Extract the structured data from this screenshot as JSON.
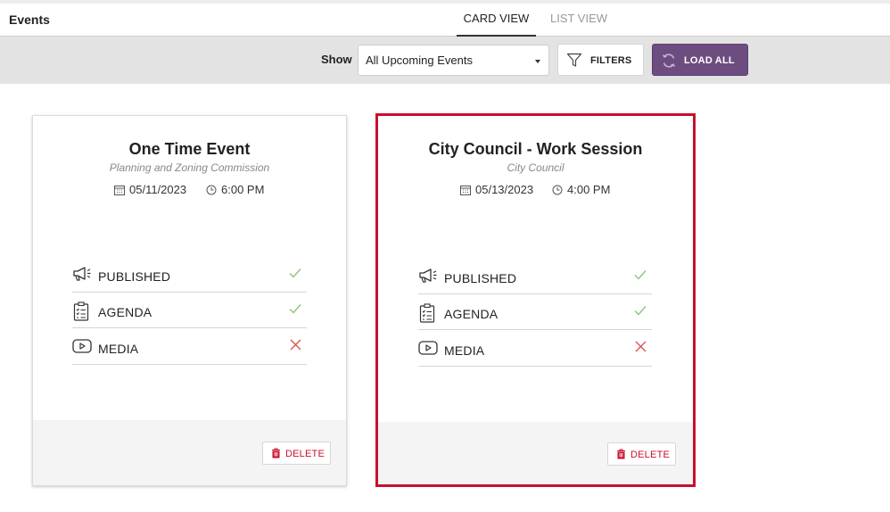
{
  "header": {
    "title": "Events",
    "tabs": [
      {
        "label": "CARD VIEW",
        "active": true
      },
      {
        "label": "LIST VIEW",
        "active": false
      }
    ]
  },
  "toolbar": {
    "show_label": "Show",
    "show_select_value": "All Upcoming Events",
    "filters_label": "FILTERS",
    "load_all_label": "LOAD ALL"
  },
  "colors": {
    "accent_purple": "#6d4d80",
    "selected_border": "#c8102e",
    "check_green": "#8cc47d",
    "cross_red": "#d9534f"
  },
  "events": [
    {
      "title": "One Time Event",
      "subtitle": "Planning and Zoning Commission",
      "date": "05/11/2023",
      "time": "6:00 PM",
      "selected": false,
      "statuses": [
        {
          "label": "PUBLISHED",
          "icon": "megaphone-icon",
          "ok": true
        },
        {
          "label": "AGENDA",
          "icon": "clipboard-list-icon",
          "ok": true
        },
        {
          "label": "MEDIA",
          "icon": "play-icon",
          "ok": false
        }
      ],
      "delete_label": "DELETE"
    },
    {
      "title": "City Council - Work Session",
      "subtitle": "City Council",
      "date": "05/13/2023",
      "time": "4:00 PM",
      "selected": true,
      "statuses": [
        {
          "label": "PUBLISHED",
          "icon": "megaphone-icon",
          "ok": true
        },
        {
          "label": "AGENDA",
          "icon": "clipboard-list-icon",
          "ok": true
        },
        {
          "label": "MEDIA",
          "icon": "play-icon",
          "ok": false
        }
      ],
      "delete_label": "DELETE"
    }
  ]
}
